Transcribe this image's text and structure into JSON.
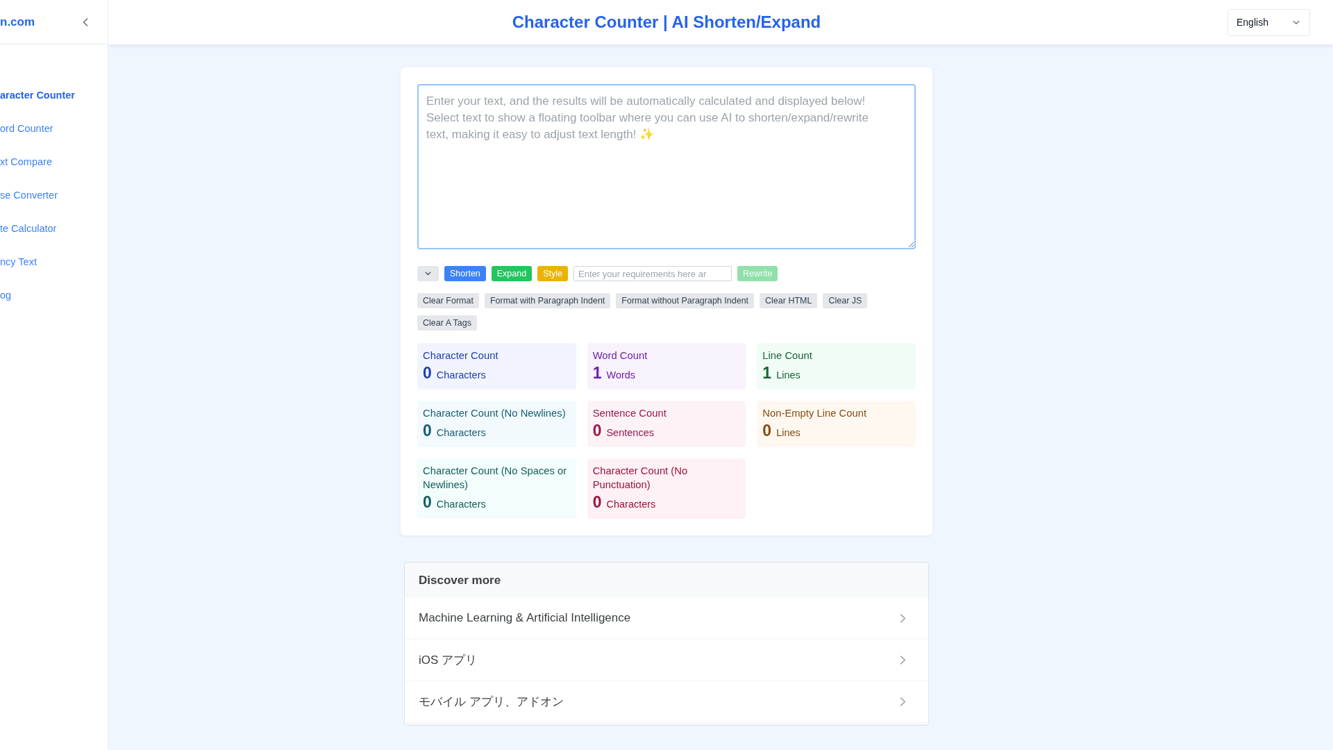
{
  "sidebar": {
    "logo": "n.com",
    "items": [
      {
        "label": "aracter Counter",
        "selected": true
      },
      {
        "label": "ord Counter",
        "selected": false
      },
      {
        "label": "xt Compare",
        "selected": false
      },
      {
        "label": "se Converter",
        "selected": false
      },
      {
        "label": "te Calculator",
        "selected": false
      },
      {
        "label": "ncy Text",
        "selected": false
      },
      {
        "label": "og",
        "selected": false
      }
    ]
  },
  "header": {
    "title": "Character Counter | AI Shorten/Expand",
    "language": "English"
  },
  "editor": {
    "placeholder": "Enter your text, and the results will be automatically calculated and displayed below! Select text to show a floating toolbar where you can use AI to shorten/expand/rewrite text, making it easy to adjust text length! ✨"
  },
  "toolbar": {
    "actions": [
      {
        "label": "Shorten",
        "color": "#3b82f6"
      },
      {
        "label": "Expand",
        "color": "#22c55e"
      },
      {
        "label": "Style",
        "color": "#eab308"
      }
    ],
    "prompt": {
      "placeholder": "Enter your requirements here ar"
    },
    "rewrite": {
      "label": "Rewrite",
      "color": "#90e0aa",
      "disabled": true
    }
  },
  "format_buttons": [
    "Clear Format",
    "Format with Paragraph Indent",
    "Format without Paragraph Indent",
    "Clear HTML",
    "Clear JS",
    "Clear A Tags"
  ],
  "stats": [
    {
      "label": "Character Count",
      "value": "0",
      "unit": "Characters",
      "color": "#1e40af"
    },
    {
      "label": "Word Count",
      "value": "1",
      "unit": "Words",
      "color": "#6b21a8"
    },
    {
      "label": "Line Count",
      "value": "1",
      "unit": "Lines",
      "color": "#166534"
    },
    {
      "label": "Character Count (No Newlines)",
      "value": "0",
      "unit": "Characters",
      "color": "#155e75"
    },
    {
      "label": "Sentence Count",
      "value": "0",
      "unit": "Sentences",
      "color": "#9d174d"
    },
    {
      "label": "Non-Empty Line Count",
      "value": "0",
      "unit": "Lines",
      "color": "#854d0e"
    },
    {
      "label": "Character Count (No Spaces or Newlines)",
      "value": "0",
      "unit": "Characters",
      "color": "#115e59"
    },
    {
      "label": "Character Count (No Punctuation)",
      "value": "0",
      "unit": "Characters",
      "color": "#9f1239"
    }
  ],
  "discover": {
    "title": "Discover more",
    "items": [
      "Machine Learning & Artificial Intelligence",
      "iOS アプリ",
      "モバイル アプリ、アドオン"
    ]
  }
}
